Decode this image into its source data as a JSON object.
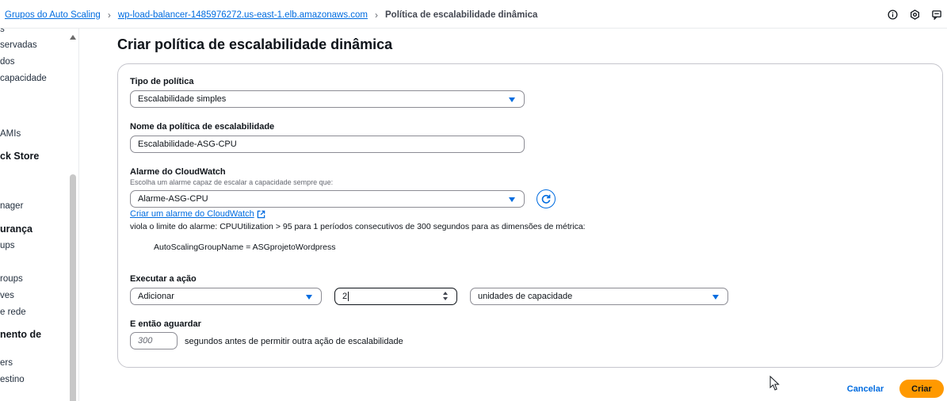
{
  "breadcrumb": {
    "items": [
      {
        "label": "Grupos do Auto Scaling"
      },
      {
        "label": "wp-load-balancer-1485976272.us-east-1.elb.amazonaws.com"
      }
    ],
    "current": "Política de escalabilidade dinâmica",
    "separator": "›"
  },
  "top_icons": [
    "info-icon",
    "settings-icon",
    "feedback-icon"
  ],
  "left_nav": {
    "items": [
      {
        "label": "s",
        "type": "item"
      },
      {
        "label": "servadas",
        "type": "item"
      },
      {
        "label": "dos",
        "type": "item"
      },
      {
        "label": "capacidade",
        "type": "item"
      },
      {
        "label": "AMIs",
        "type": "item"
      },
      {
        "label": "ck Store",
        "type": "head"
      },
      {
        "label": "nager",
        "type": "item"
      },
      {
        "label": "urança",
        "type": "head"
      },
      {
        "label": "ups",
        "type": "item"
      },
      {
        "label": "roups",
        "type": "item"
      },
      {
        "label": "ves",
        "type": "item"
      },
      {
        "label": "e rede",
        "type": "item"
      },
      {
        "label": "nento de",
        "type": "head"
      },
      {
        "label": "ers",
        "type": "item"
      },
      {
        "label": "estino",
        "type": "item"
      }
    ]
  },
  "page_title": "Criar política de escalabilidade dinâmica",
  "form": {
    "policy_type": {
      "label": "Tipo de política",
      "value": "Escalabilidade simples"
    },
    "policy_name": {
      "label": "Nome da política de escalabilidade",
      "value": "Escalabilidade-ASG-CPU"
    },
    "alarm": {
      "label": "Alarme do CloudWatch",
      "description": "Escolha um alarme capaz de escalar a capacidade sempre que:",
      "value": "Alarme-ASG-CPU",
      "create_link": "Criar um alarme do CloudWatch",
      "condition": "viola o limite do alarme: CPUUtilization > 95 para 1 períodos consecutivos de 300 segundos para as dimensões de métrica:",
      "dimension": "AutoScalingGroupName = ASGprojetoWordpress"
    },
    "action": {
      "label": "Executar a ação",
      "operation": "Adicionar",
      "amount": "2",
      "unit": "unidades de capacidade"
    },
    "wait": {
      "label": "E então aguardar",
      "placeholder": "300",
      "suffix": "segundos antes de permitir outra ação de escalabilidade"
    }
  },
  "footer": {
    "cancel_label": "Cancelar",
    "create_label": "Criar"
  },
  "colors": {
    "link": "#006ce0",
    "primary": "#ff9900",
    "border": "#8c8c94"
  }
}
